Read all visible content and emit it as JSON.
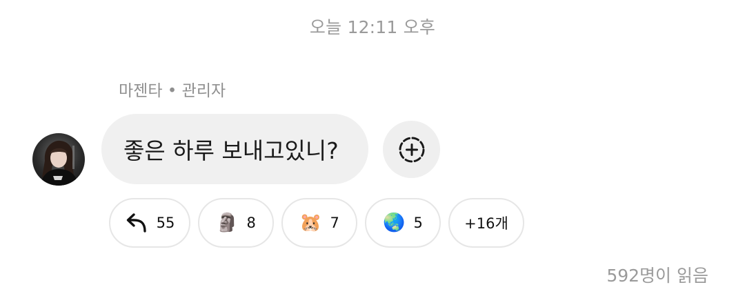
{
  "timestamp": "오늘 12:11 오후",
  "sender": "마젠타 • 관리자",
  "message": "좋은 하루 보내고있니?",
  "reactions": [
    {
      "icon": "reply-arrow-icon",
      "count": "55"
    },
    {
      "emoji": "🗿",
      "count": "8"
    },
    {
      "emoji": "🐹",
      "count": "7"
    },
    {
      "emoji": "🌏",
      "count": "5"
    }
  ],
  "more_reactions": "+16개",
  "read_count": "592명이 읽음"
}
